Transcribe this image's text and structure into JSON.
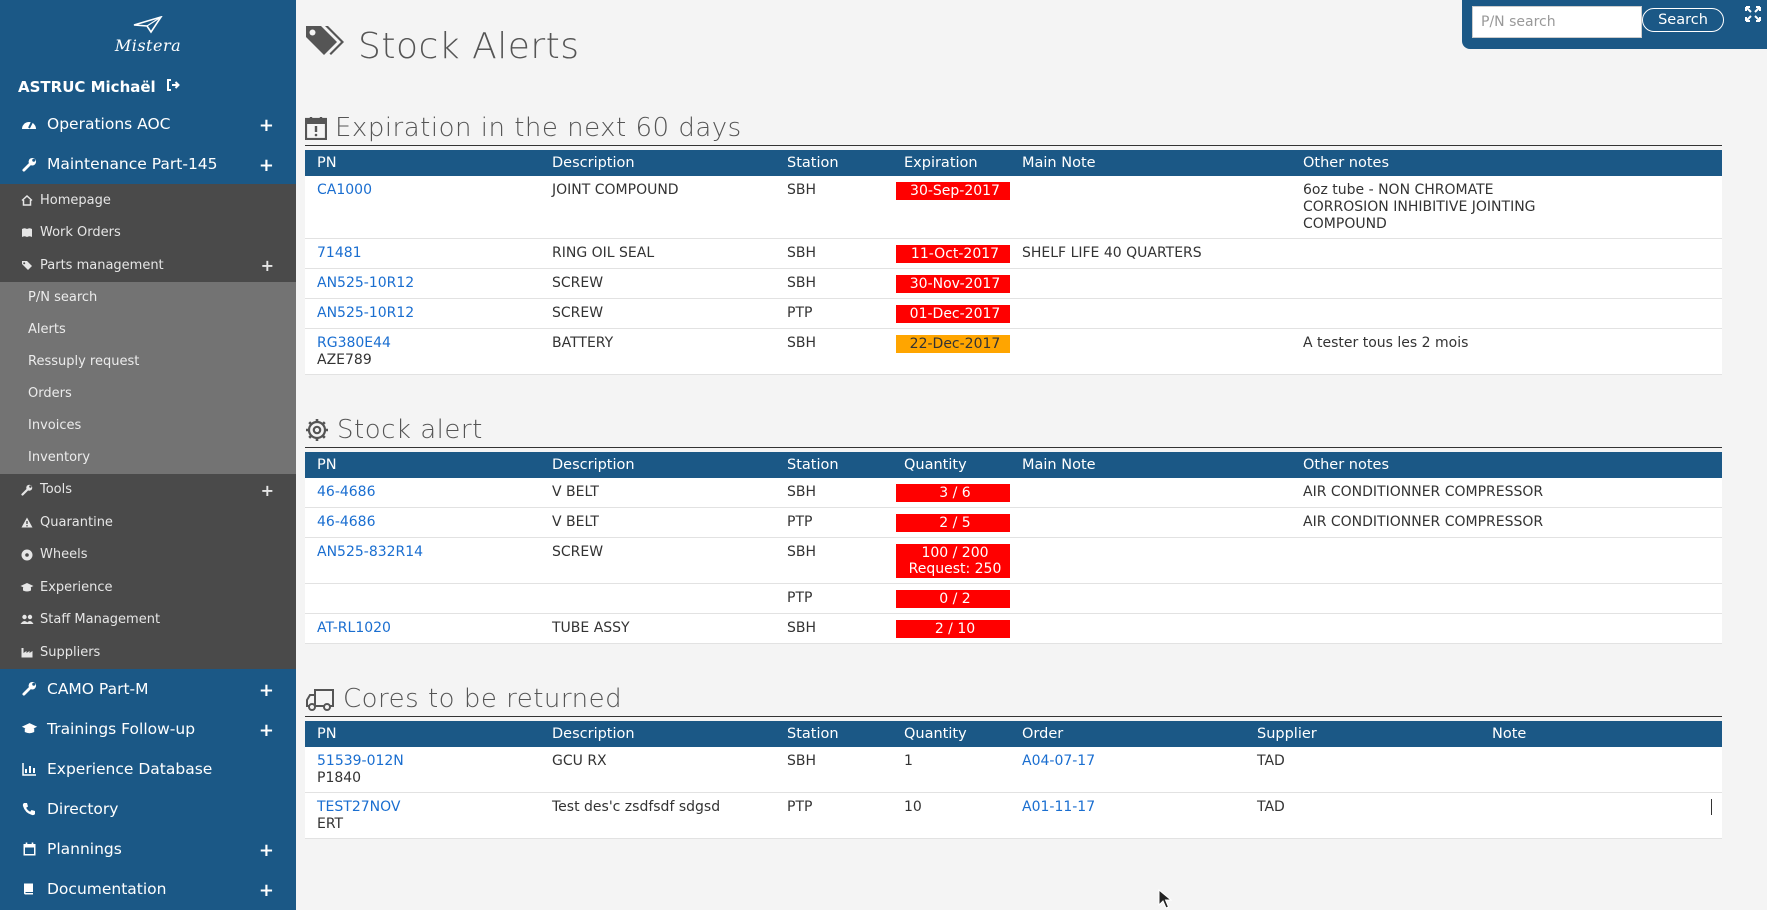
{
  "sidebar": {
    "logo_text": "Mistera",
    "user": "ASTRUC Michaël",
    "top_items": [
      {
        "label": "Operations AOC",
        "icon": "gauge-icon"
      },
      {
        "label": "Maintenance Part-145",
        "icon": "wrench-icon"
      }
    ],
    "maintenance_sub": [
      {
        "label": "Homepage",
        "icon": "home-icon"
      },
      {
        "label": "Work Orders",
        "icon": "book-icon"
      },
      {
        "label": "Parts management",
        "icon": "tags-icon"
      }
    ],
    "parts_sub": [
      "P/N search",
      "Alerts",
      "Ressuply request",
      "Orders",
      "Invoices",
      "Inventory"
    ],
    "maintenance_sub2": [
      {
        "label": "Tools",
        "icon": "wrench-icon"
      },
      {
        "label": "Quarantine",
        "icon": "warning-icon"
      },
      {
        "label": "Wheels",
        "icon": "wheel-icon"
      },
      {
        "label": "Experience",
        "icon": "graduation-icon"
      },
      {
        "label": "Staff Management",
        "icon": "users-icon"
      },
      {
        "label": "Suppliers",
        "icon": "factory-icon"
      }
    ],
    "bottom_items": [
      {
        "label": "CAMO Part-M",
        "icon": "wrench-icon"
      },
      {
        "label": "Trainings Follow-up",
        "icon": "graduation-icon"
      },
      {
        "label": "Experience Database",
        "icon": "chart-icon"
      },
      {
        "label": "Directory",
        "icon": "phone-icon"
      },
      {
        "label": "Plannings",
        "icon": "calendar-icon"
      },
      {
        "label": "Documentation",
        "icon": "book-icon"
      }
    ]
  },
  "page": {
    "title": "Stock Alerts",
    "search_placeholder": "P/N search",
    "search_button": "Search"
  },
  "expiration": {
    "title": "Expiration in the next 60 days",
    "headers": [
      "PN",
      "Description",
      "Station",
      "Expiration",
      "Main Note",
      "Other notes"
    ],
    "rows": [
      {
        "pn": "CA1000",
        "pn2": "",
        "desc": "JOINT COMPOUND",
        "station": "SBH",
        "date": "30-Sep-2017",
        "color": "red",
        "main_note": "",
        "other": "6oz tube - NON CHROMATE CORROSION INHIBITIVE JOINTING COMPOUND"
      },
      {
        "pn": "71481",
        "pn2": "",
        "desc": "RING OIL SEAL",
        "station": "SBH",
        "date": "11-Oct-2017",
        "color": "red",
        "main_note": "SHELF LIFE 40 QUARTERS",
        "other": ""
      },
      {
        "pn": "AN525-10R12",
        "pn2": "",
        "desc": "SCREW",
        "station": "SBH",
        "date": "30-Nov-2017",
        "color": "red",
        "main_note": "",
        "other": ""
      },
      {
        "pn": "AN525-10R12",
        "pn2": "",
        "desc": "SCREW",
        "station": "PTP",
        "date": "01-Dec-2017",
        "color": "red",
        "main_note": "",
        "other": ""
      },
      {
        "pn": "RG380E44",
        "pn2": "AZE789",
        "desc": "BATTERY",
        "station": "SBH",
        "date": "22-Dec-2017",
        "color": "orange",
        "main_note": "",
        "other": "A tester tous les 2 mois"
      }
    ]
  },
  "stock": {
    "title": "Stock alert",
    "headers": [
      "PN",
      "Description",
      "Station",
      "Quantity",
      "Main Note",
      "Other notes"
    ],
    "rows": [
      {
        "pn": "46-4686",
        "desc": "V BELT",
        "station": "SBH",
        "qty": "3 / 6",
        "qty2": "",
        "main_note": "",
        "other": "AIR CONDITIONNER COMPRESSOR"
      },
      {
        "pn": "46-4686",
        "desc": "V BELT",
        "station": "PTP",
        "qty": "2 / 5",
        "qty2": "",
        "main_note": "",
        "other": "AIR CONDITIONNER COMPRESSOR"
      },
      {
        "pn": "AN525-832R14",
        "desc": "SCREW",
        "station": "SBH",
        "qty": "100 / 200",
        "qty2": "Request: 250",
        "main_note": "",
        "other": ""
      },
      {
        "pn": "",
        "desc": "",
        "station": "PTP",
        "qty": "0 / 2",
        "qty2": "",
        "main_note": "",
        "other": ""
      },
      {
        "pn": "AT-RL1020",
        "desc": "TUBE ASSY",
        "station": "SBH",
        "qty": "2 / 10",
        "qty2": "",
        "main_note": "",
        "other": ""
      }
    ]
  },
  "cores": {
    "title": "Cores to be returned",
    "headers": [
      "PN",
      "Description",
      "Station",
      "Quantity",
      "Order",
      "Supplier",
      "Note"
    ],
    "rows": [
      {
        "pn": "51539-012N",
        "pn2": "P1840",
        "desc": "GCU RX",
        "station": "SBH",
        "qty": "1",
        "order": "A04-07-17",
        "supplier": "TAD",
        "note": ""
      },
      {
        "pn": "TEST27NOV",
        "pn2": "ERT",
        "desc": "Test des'c zsdfsdf sdgsd",
        "station": "PTP",
        "qty": "10",
        "order": "A01-11-17",
        "supplier": "TAD",
        "note": ""
      }
    ]
  },
  "colors": {
    "brand": "#1b5886",
    "alert_red": "#ff0000",
    "alert_orange": "#ffa500",
    "link": "#1a6ed0"
  }
}
